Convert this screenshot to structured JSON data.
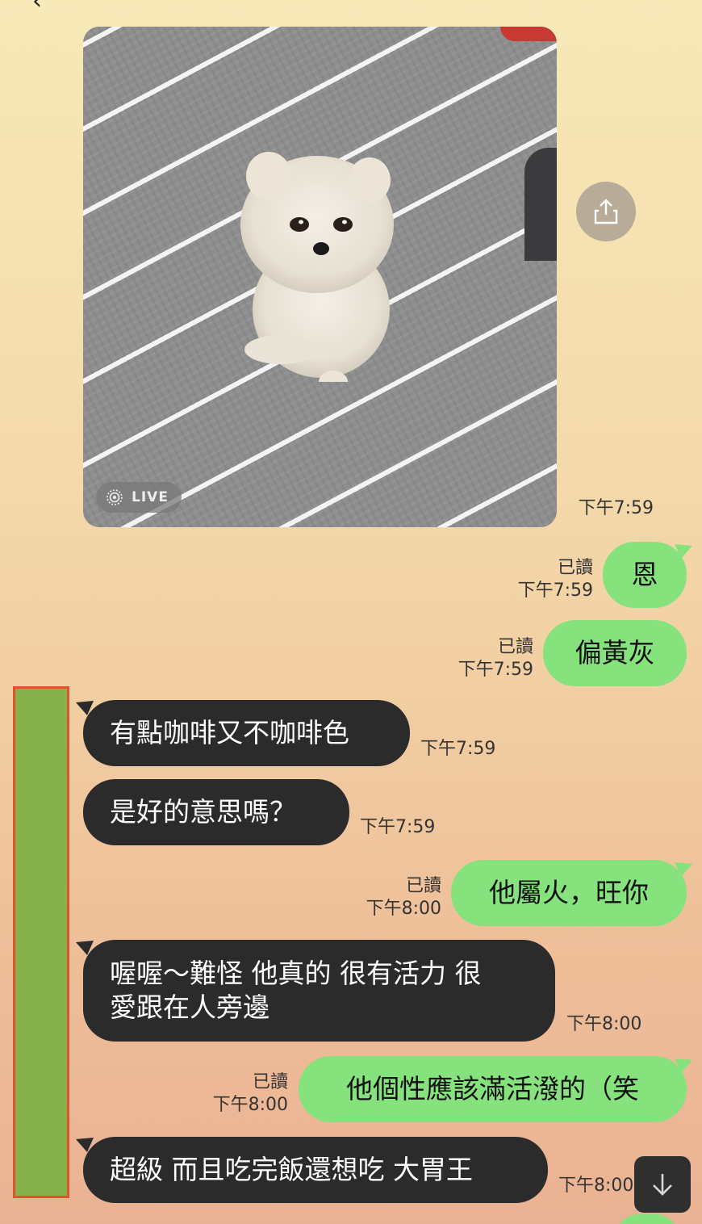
{
  "photo": {
    "live_label": "LIVE",
    "timestamp": "下午7:59"
  },
  "messages": [
    {
      "side": "mine",
      "text": "恩",
      "read": "已讀",
      "time": "下午7:59"
    },
    {
      "side": "mine",
      "text": "偏黃灰",
      "read": "已讀",
      "time": "下午7:59"
    },
    {
      "side": "theirs",
      "text": "有點咖啡又不咖啡色",
      "time": "下午7:59"
    },
    {
      "side": "theirs",
      "text": "是好的意思嗎？",
      "time": "下午7:59"
    },
    {
      "side": "mine",
      "text": "他屬火，旺你",
      "read": "已讀",
      "time": "下午8:00"
    },
    {
      "side": "theirs",
      "line1": "喔喔～難怪 他真的 很有活力 很",
      "line2": "愛跟在人旁邊",
      "time": "下午8:00"
    },
    {
      "side": "mine",
      "text": "他個性應該滿活潑的（笑",
      "read": "已讀",
      "time": "下午8:00"
    },
    {
      "side": "theirs",
      "text": "超級 而且吃完飯還想吃 大胃王",
      "time": "下午8:00"
    }
  ],
  "colors": {
    "mine_bubble": "#86e27c",
    "theirs_bubble": "#2b2b2b",
    "redaction": "#86b24b",
    "redaction_border": "#e0532e"
  },
  "icons": {
    "share": "share-icon",
    "scroll_down": "arrow-down-icon",
    "live": "live-photo-icon"
  }
}
